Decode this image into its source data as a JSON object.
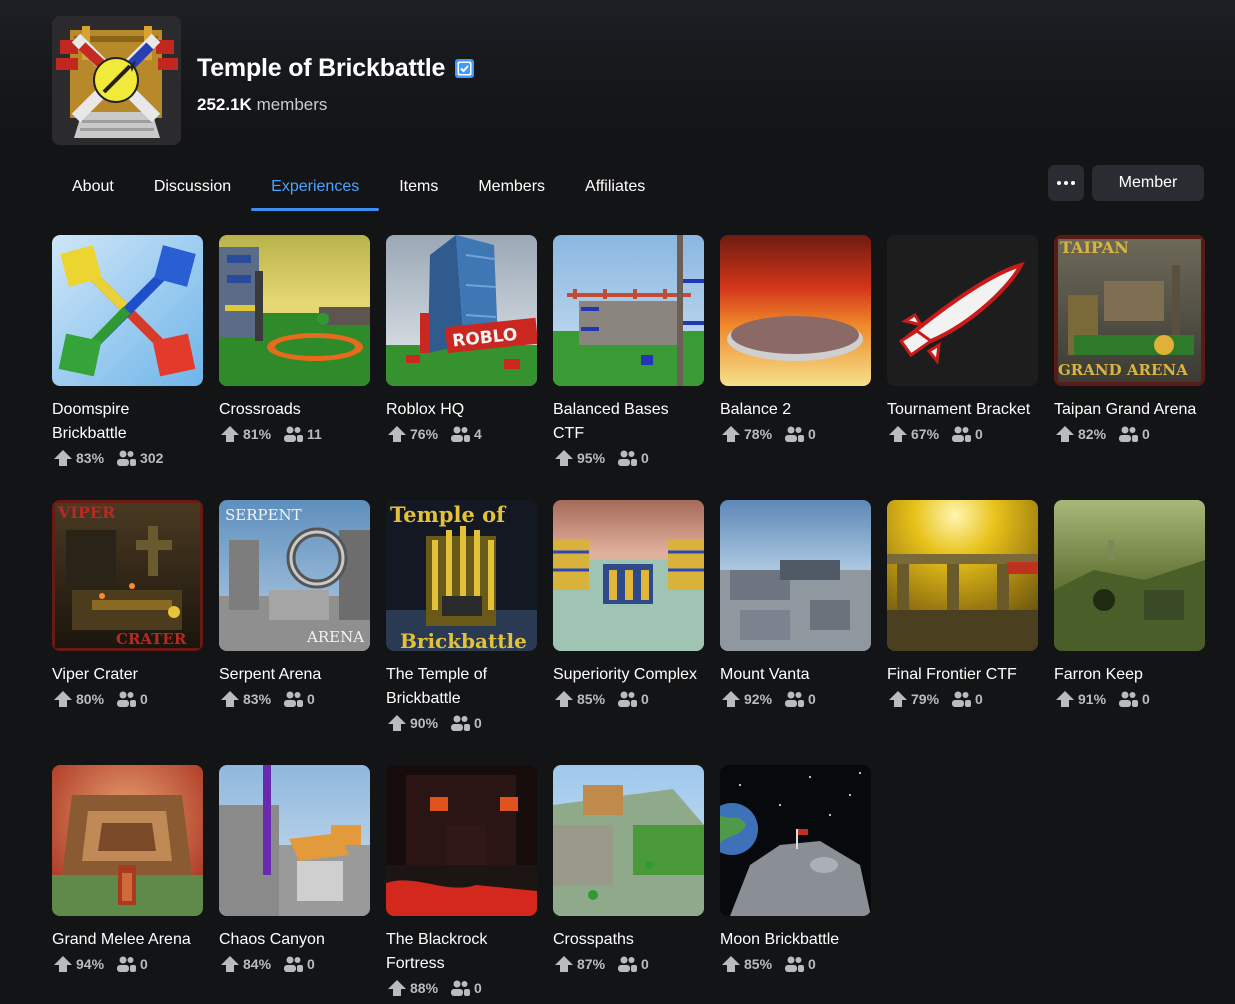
{
  "group": {
    "name": "Temple of Brickbattle",
    "members_count": "252.1K",
    "members_label": "members"
  },
  "tabs": [
    {
      "label": "About",
      "active": false
    },
    {
      "label": "Discussion",
      "active": false
    },
    {
      "label": "Experiences",
      "active": true
    },
    {
      "label": "Items",
      "active": false
    },
    {
      "label": "Members",
      "active": false
    },
    {
      "label": "Affiliates",
      "active": false
    }
  ],
  "actions": {
    "more_icon": "ellipsis-icon",
    "member_label": "Member"
  },
  "experiences": [
    {
      "name": "Doomspire Brickbattle",
      "rating": "83%",
      "players": "302"
    },
    {
      "name": "Crossroads",
      "rating": "81%",
      "players": "11"
    },
    {
      "name": "Roblox HQ",
      "rating": "76%",
      "players": "4"
    },
    {
      "name": "Balanced Bases CTF",
      "rating": "95%",
      "players": "0"
    },
    {
      "name": "Balance 2",
      "rating": "78%",
      "players": "0"
    },
    {
      "name": "Tournament Bracket",
      "rating": "67%",
      "players": "0"
    },
    {
      "name": "Taipan Grand Arena",
      "rating": "82%",
      "players": "0"
    },
    {
      "name": "Viper Crater",
      "rating": "80%",
      "players": "0"
    },
    {
      "name": "Serpent Arena",
      "rating": "83%",
      "players": "0"
    },
    {
      "name": "The Temple of Brickbattle",
      "rating": "90%",
      "players": "0"
    },
    {
      "name": "Superiority Complex",
      "rating": "85%",
      "players": "0"
    },
    {
      "name": "Mount Vanta",
      "rating": "92%",
      "players": "0"
    },
    {
      "name": "Final Frontier CTF",
      "rating": "79%",
      "players": "0"
    },
    {
      "name": "Farron Keep",
      "rating": "91%",
      "players": "0"
    },
    {
      "name": "Grand Melee Arena",
      "rating": "94%",
      "players": "0"
    },
    {
      "name": "Chaos Canyon",
      "rating": "84%",
      "players": "0"
    },
    {
      "name": "The Blackrock Fortress",
      "rating": "88%",
      "players": "0"
    },
    {
      "name": "Crosspaths",
      "rating": "87%",
      "players": "0"
    },
    {
      "name": "Moon Brickbattle",
      "rating": "85%",
      "players": "0"
    }
  ],
  "thumbnail_text": {
    "roblox_sign": "ROBLO",
    "taipan_top": "TAIPAN",
    "taipan_bottom": "GRAND ARENA",
    "viper_top": "VIPER",
    "viper_bottom": "CRATER",
    "serpent_top": "SERPENT",
    "serpent_bottom": "ARENA",
    "temple_top": "Temple of",
    "temple_bottom": "Brickbattle"
  },
  "colors": {
    "accent": "#3d8ef0",
    "verified": "#3d9bff",
    "background": "#131416"
  }
}
